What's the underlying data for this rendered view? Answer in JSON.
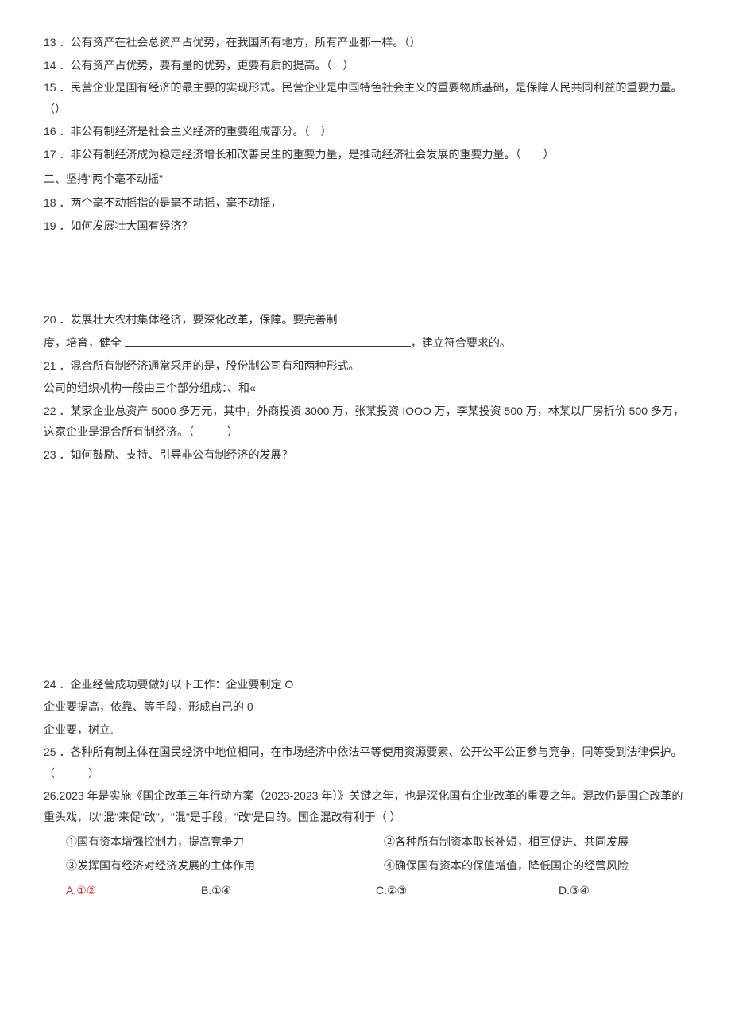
{
  "q13": "13 ．公有资产在社会总资产占优势，在我国所有地方，所有产业都一样。（）",
  "q14": "14 ．公有资产占优势，要有量的优势，更要有质的提高。（　）",
  "q15": "15 ．民营企业是国有经济的最主要的实现形式。民营企业是中国特色社会主义的重要物质基础，是保障人民共同利益的重要力量。（）",
  "q16": "16 ．非公有制经济是社会主义经济的重要组成部分。（　）",
  "q17": "17 ．非公有制经济成为稳定经济增长和改善民生的重要力量，是推动经济社会发展的重要力量。（　　）",
  "section2": "二、坚持\"两个毫不动摇\"",
  "q18": "18 ．两个毫不动摇指的是毫不动摇，毫不动摇，",
  "q19": "19 ．如何发展壮大国有经济？",
  "q20": "20 ．发展壮大农村集体经济，要深化改革，保障。要完善制",
  "q20b_pre": "度，培育，健全 ",
  "q20b_post": "，建立符合要求的。",
  "q21": "21 ．混合所有制经济通常采用的是，股份制公司有和两种形式。",
  "q21b": "公司的组织机构一般由三个部分组成：、和«",
  "q22": "22 ．某家企业总资产 5000 多万元，其中，外商投资 3000 万，张某投资 IOOO 万，李某投资 500 万，林某以厂房折价 500 多万，这家企业是混合所有制经济。（　　　）",
  "q23": "23 ．如何鼓励、支持、引导非公有制经济的发展？",
  "q24": "24 ．企业经营成功要做好以下工作：企业要制定 O",
  "q24b": "企业要提高，依靠、等手段，形成自己的 0",
  "q24c": "企业要，树立.",
  "q25": "25 ．各种所有制主体在国民经济中地位相同，在市场经济中依法平等使用资源要素、公开公平公正参与竞争，同等受到法律保护。（　　　）",
  "q26": "26.2023 年是实施《国企改革三年行动方案（2023-2023 年）》关键之年，也是深化国有企业改革的重要之年。混改仍是国企改革的重头戏，以\"混\"来促\"改\"，\"混\"是手段，\"改\"是目的。国企混改有利于（ ）",
  "opt1": "①国有资本增强控制力，提高竞争力",
  "opt2": "②各种所有制资本取长补短，相互促进、共同发展",
  "opt3": "③发挥国有经济对经济发展的主体作用",
  "opt4": "④确保国有资本的保值增值，降低国企的经营风险",
  "choiceA": "A.①②",
  "choiceB": "B.①④",
  "choiceC": "C.②③",
  "choiceD": "D.③④"
}
